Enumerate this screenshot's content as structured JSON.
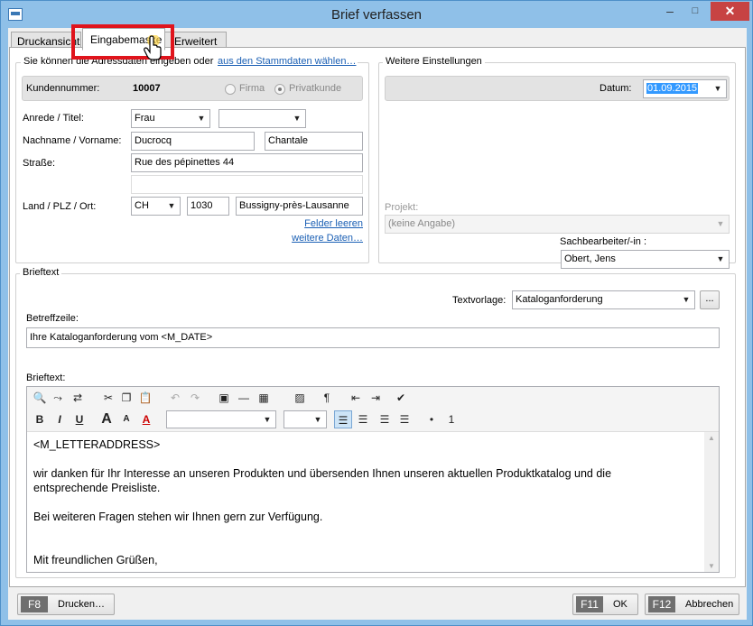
{
  "window": {
    "title": "Brief verfassen",
    "minimize": "–",
    "maximize": "□",
    "close": "✕"
  },
  "tabs": [
    {
      "label": "Druckansicht",
      "active": false
    },
    {
      "label": "Eingabemaske",
      "active": true
    },
    {
      "label": "Erweitert",
      "active": false
    }
  ],
  "address": {
    "hint_text": "Sie können die Adressdaten eingeben oder",
    "hint_link": "aus den Stammdaten wählen…",
    "customer_label": "Kundennummer:",
    "customer_number": "10007",
    "radio_firma": "Firma",
    "radio_privat": "Privatkunde",
    "salutation_label": "Anrede / Titel:",
    "salutation": "Frau",
    "title_value": "",
    "name_label": "Nachname / Vorname:",
    "lastname": "Ducrocq",
    "firstname": "Chantale",
    "street_label": "Straße:",
    "street": "Rue des pépinettes 44",
    "country_label": "Land / PLZ / Ort:",
    "country": "CH",
    "zip": "1030",
    "city": "Bussigny-près-Lausanne",
    "clear_link": "Felder leeren",
    "more_link": "weitere Daten…"
  },
  "settings": {
    "group_label": "Weitere Einstellungen",
    "date_label": "Datum:",
    "date": "01.09.2015",
    "project_label": "Projekt:",
    "project": "(keine Angabe)",
    "clerk_label": "Sachbearbeiter/-in :",
    "clerk": "Obert, Jens"
  },
  "letter": {
    "group_label": "Brieftext",
    "template_label": "Textvorlage:",
    "template": "Kataloganforderung",
    "template_more": "...",
    "subject_label": "Betreffzeile:",
    "subject": "Ihre Kataloganforderung vom <M_DATE>",
    "body_label": "Brieftext:",
    "body": [
      "<M_LETTERADDRESS>",
      "wir danken für Ihr Interesse an unseren Produkten und übersenden Ihnen unseren aktuellen Produktkatalog und die",
      "entsprechende Preisliste.",
      "Bei weiteren Fragen stehen wir Ihnen gern zur Verfügung.",
      "Mit freundlichen Grüßen,"
    ]
  },
  "toolbar": {
    "row1": [
      {
        "name": "find-icon",
        "glyph": "🔍"
      },
      {
        "name": "find-next-icon",
        "glyph": "⤳"
      },
      {
        "name": "replace-icon",
        "glyph": "⇄"
      },
      {
        "name": "cut-icon",
        "glyph": "✂"
      },
      {
        "name": "copy-icon",
        "glyph": "❐"
      },
      {
        "name": "paste-icon",
        "glyph": "📋"
      },
      {
        "name": "undo-icon",
        "glyph": "↶"
      },
      {
        "name": "redo-icon",
        "glyph": "↷"
      },
      {
        "name": "page-icon",
        "glyph": "▣"
      },
      {
        "name": "horizontal-line-icon",
        "glyph": "—"
      },
      {
        "name": "table-icon",
        "glyph": "▦"
      },
      {
        "name": "image-icon",
        "glyph": "▨"
      },
      {
        "name": "paragraph-icon",
        "glyph": "¶"
      },
      {
        "name": "outdent-icon",
        "glyph": "⇤"
      },
      {
        "name": "indent-icon",
        "glyph": "⇥"
      },
      {
        "name": "spellcheck-icon",
        "glyph": "✔"
      }
    ],
    "row2": [
      {
        "name": "bold-icon",
        "glyph": "B"
      },
      {
        "name": "italic-icon",
        "glyph": "I"
      },
      {
        "name": "underline-icon",
        "glyph": "U"
      },
      {
        "name": "font-grow-icon",
        "glyph": "A"
      },
      {
        "name": "font-shrink-icon",
        "glyph": "A"
      },
      {
        "name": "font-color-icon",
        "glyph": "A"
      },
      {
        "name": "align-left-icon",
        "glyph": "☰"
      },
      {
        "name": "align-center-icon",
        "glyph": "☰"
      },
      {
        "name": "align-right-icon",
        "glyph": "☰"
      },
      {
        "name": "justify-icon",
        "glyph": "☰"
      },
      {
        "name": "bullet-list-icon",
        "glyph": "•"
      },
      {
        "name": "numbered-list-icon",
        "glyph": "1"
      }
    ],
    "font_value": "",
    "size_value": ""
  },
  "footer": {
    "print_key": "F8",
    "print_label": "Drucken…",
    "ok_key": "F11",
    "ok_label": "OK",
    "cancel_key": "F12",
    "cancel_label": "Abbrechen"
  },
  "colors": {
    "highlight_box": "#e0141c",
    "link": "#1a5fb4",
    "selection": "#3399ff"
  }
}
